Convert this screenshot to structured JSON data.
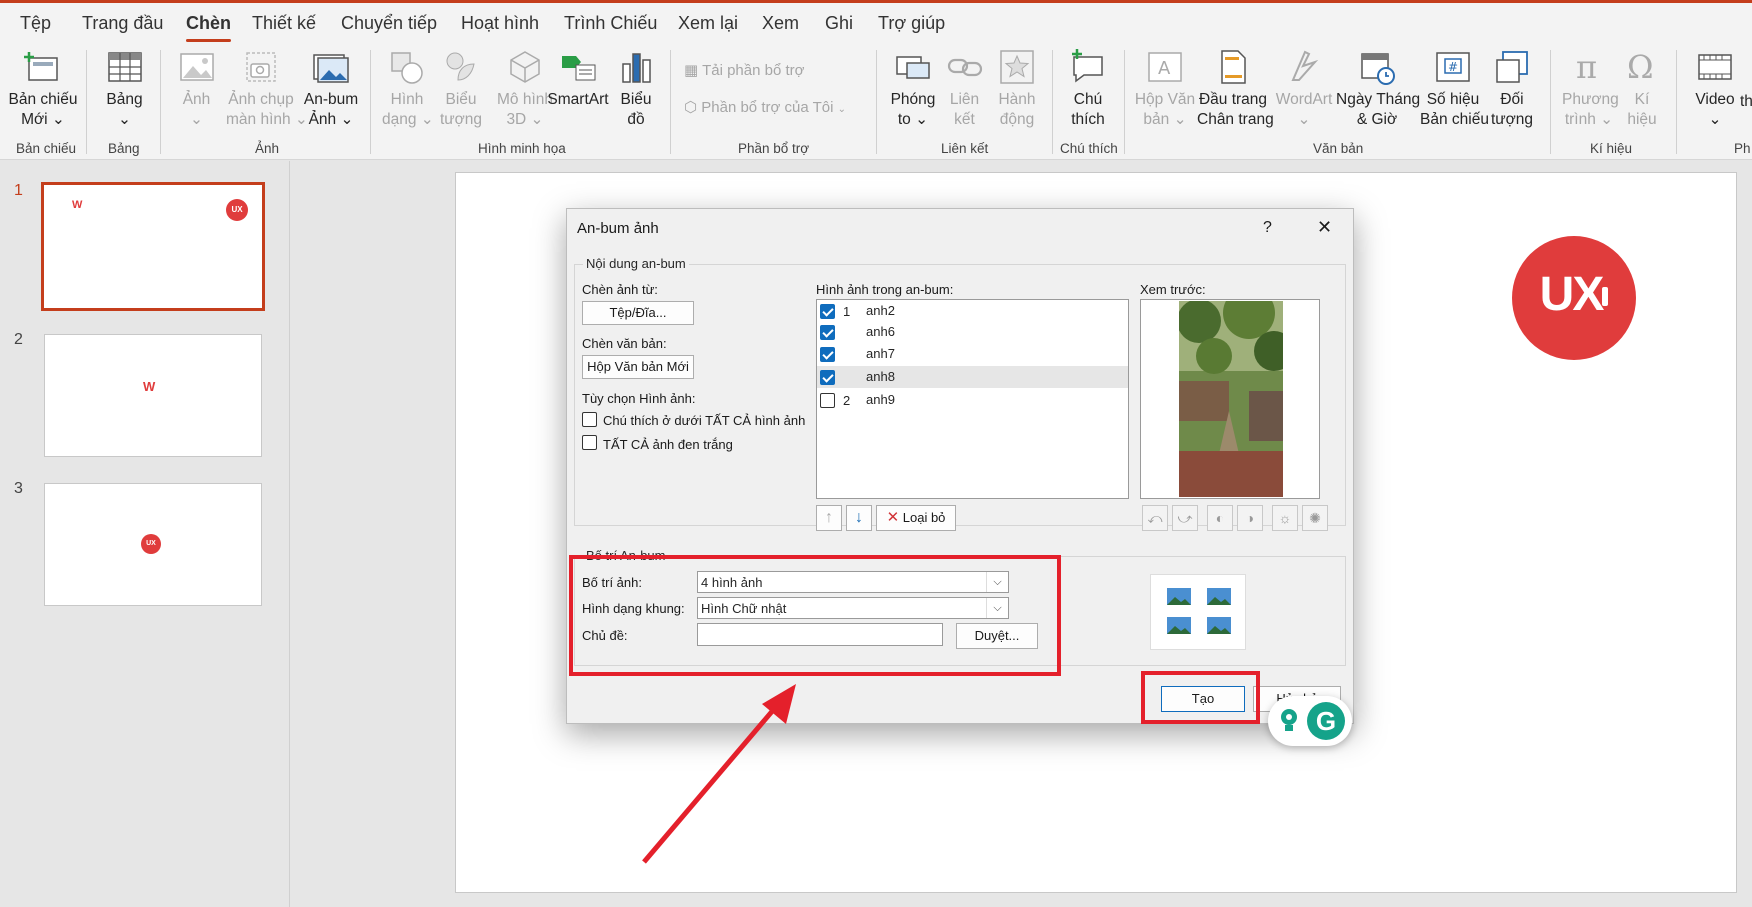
{
  "tabs": [
    "Tệp",
    "Trang đầu",
    "Chèn",
    "Thiết kế",
    "Chuyển tiếp",
    "Hoạt hình",
    "Trình Chiếu",
    "Xem lại",
    "Xem",
    "Ghi",
    "Trợ giúp"
  ],
  "ribbon": {
    "new_slide": [
      "Bản chiếu",
      "Mới ⌄"
    ],
    "table": [
      "Bảng",
      "⌄"
    ],
    "image": [
      "Ảnh",
      "⌄"
    ],
    "screenshot": [
      "Ảnh chụp",
      "màn hình ⌄"
    ],
    "album": [
      "An-bum",
      "Ảnh ⌄"
    ],
    "shapes": [
      "Hình",
      "dạng ⌄"
    ],
    "icons": [
      "Biểu",
      "tượng"
    ],
    "models3d": [
      "Mô hình",
      "3D ⌄"
    ],
    "smartart": "SmartArt",
    "chart": [
      "Biểu",
      "đồ"
    ],
    "get_addins": "Tải phần bổ trợ",
    "my_addins": "Phần bổ trợ của Tôi",
    "zoom": [
      "Phóng",
      "to ⌄"
    ],
    "link": [
      "Liên",
      "kết"
    ],
    "action": [
      "Hành",
      "động"
    ],
    "comment": [
      "Chú",
      "thích"
    ],
    "textbox": [
      "Hộp Văn",
      "bản ⌄"
    ],
    "header_footer": [
      "Đầu trang",
      "Chân trang"
    ],
    "wordart": [
      "WordArt",
      "⌄"
    ],
    "datetime": [
      "Ngày Tháng",
      "& Giờ"
    ],
    "slide_number": [
      "Số hiệu",
      "Bản chiếu"
    ],
    "object": [
      "Đối",
      "tượng"
    ],
    "equation": [
      "Phương",
      "trình ⌄"
    ],
    "symbol": [
      "Kí",
      "hiệu"
    ],
    "video": [
      "Video",
      "⌄"
    ],
    "cut_off": [
      "th"
    ],
    "groups": {
      "slides": "Bản chiếu",
      "tables": "Bảng",
      "images": "Ảnh",
      "illustrations": "Hình minh họa",
      "addins": "Phần bổ trợ",
      "links": "Liên kết",
      "comments": "Chú thích",
      "text": "Văn bản",
      "symbols": "Kí hiệu",
      "media": "Ph"
    }
  },
  "slides": [
    "1",
    "2",
    "3"
  ],
  "logo_text": {
    "ux": "UX",
    ".vn": ".vn"
  },
  "dialog": {
    "title": "An-bum ảnh",
    "help": "?",
    "close": "✕",
    "album_content": "Nội dung an-bum",
    "insert_from": "Chèn ảnh từ:",
    "file_disk": "Tệp/Đĩa...",
    "insert_text": "Chèn văn bản:",
    "new_textbox": "Hộp Văn bản Mới",
    "picture_options": "Tùy chọn Hình ảnh:",
    "captions": "Chú thích ở dưới TẤT CẢ hình ảnh",
    "black_white": "TẤT CẢ ảnh đen trắng",
    "pictures_in_album": "Hình ảnh trong an-bum:",
    "pictures": [
      {
        "num": "1",
        "name": "anh2",
        "checked": true
      },
      {
        "num": "",
        "name": "anh6",
        "checked": true
      },
      {
        "num": "",
        "name": "anh7",
        "checked": true
      },
      {
        "num": "",
        "name": "anh8",
        "checked": true
      },
      {
        "num": "2",
        "name": "anh9",
        "checked": false
      }
    ],
    "remove": "Loại bỏ",
    "preview": "Xem trước:",
    "album_layout": "Bố trí An-bum",
    "picture_layout_label": "Bố trí ảnh:",
    "picture_layout_value": "4 hình ảnh",
    "frame_shape_label": "Hình dạng khung:",
    "frame_shape_value": "Hình Chữ nhật",
    "theme_label": "Chủ đề:",
    "theme_value": "",
    "browse": "Duyệt...",
    "create": "Tạo",
    "cancel": "Hủy bỏ"
  }
}
